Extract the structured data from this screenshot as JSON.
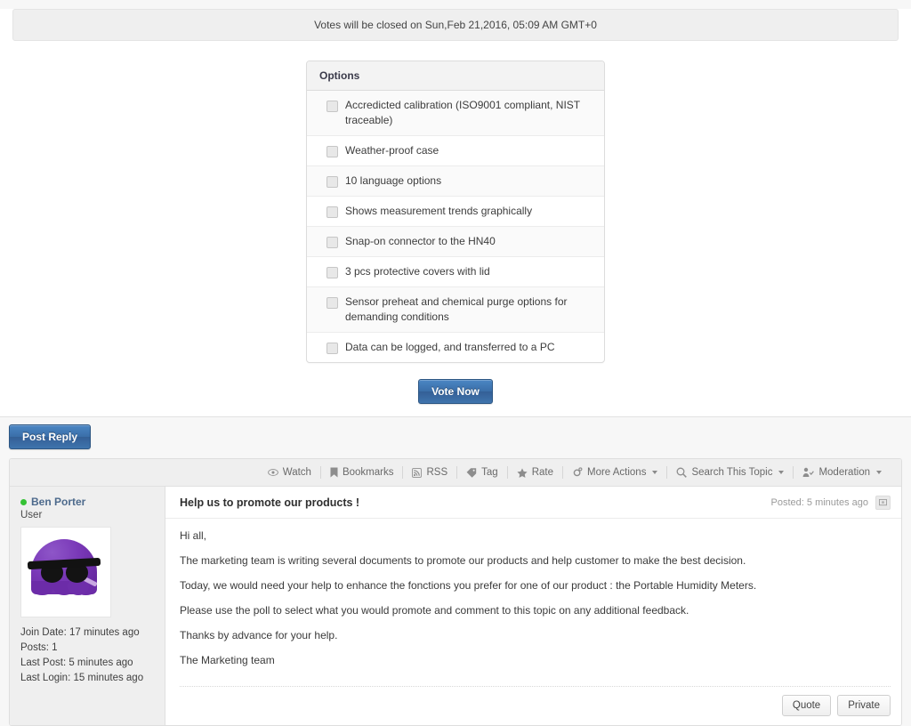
{
  "poll": {
    "notice": "Votes will be closed on Sun,Feb 21,2016, 05:09 AM GMT+0",
    "header": "Options",
    "options": [
      "Accredicted calibration (ISO9001 compliant, NIST traceable)",
      "Weather-proof case",
      "10 language options",
      "Shows measurement trends graphically",
      "Snap-on connector to the HN40",
      "3 pcs protective covers with lid",
      "Sensor preheat and chemical purge options for demanding conditions",
      "Data can be logged, and transferred to a PC"
    ],
    "vote_button": "Vote Now"
  },
  "reply": {
    "post_reply_label": "Post Reply"
  },
  "toolbar": {
    "items": [
      {
        "label": "Watch",
        "icon": "eye-icon",
        "caret": false
      },
      {
        "label": "Bookmarks",
        "icon": "bookmark-icon",
        "caret": false
      },
      {
        "label": "RSS",
        "icon": "rss-icon",
        "caret": false
      },
      {
        "label": "Tag",
        "icon": "tag-icon",
        "caret": false
      },
      {
        "label": "Rate",
        "icon": "star-icon",
        "caret": false
      },
      {
        "label": "More Actions",
        "icon": "gear-icon",
        "caret": true
      },
      {
        "label": "Search This Topic",
        "icon": "search-icon",
        "caret": true
      },
      {
        "label": "Moderation",
        "icon": "user-check-icon",
        "caret": true
      }
    ]
  },
  "post": {
    "user": {
      "name": "Ben Porter",
      "role": "User",
      "status": "online",
      "stats": [
        "Join Date: 17 minutes ago",
        "Posts: 1",
        "Last Post: 5 minutes ago",
        "Last Login: 15 minutes ago"
      ]
    },
    "title": "Help us to promote our products !",
    "posted": "Posted: 5 minutes ago",
    "paragraphs": [
      "Hi all,",
      "The marketing  team is writing several documents to promote our products and help customer to make the best decision.",
      "Today, we would need your help to enhance the fonctions you prefer for one of our product : the Portable Humidity Meters.",
      "Please use the poll to select what you would promote and comment to this topic on any additional feedback.",
      "Thanks by advance for your help.",
      "The Marketing team"
    ],
    "actions": {
      "quote": "Quote",
      "private": "Private"
    }
  },
  "colors": {
    "accent_blue": "#3a6ea8",
    "username": "#4d6a8c",
    "online_green": "#35c234"
  }
}
